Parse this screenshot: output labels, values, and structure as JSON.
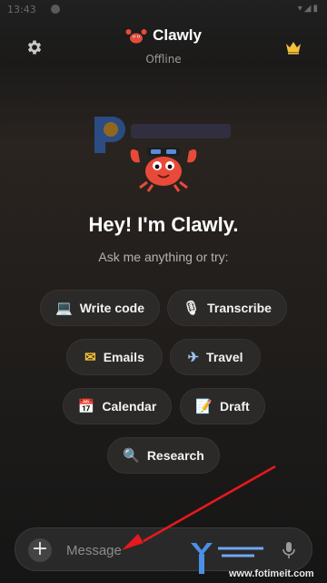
{
  "status_bar": {
    "time": "13:43"
  },
  "header": {
    "app_name": "Clawly",
    "status": "Offline",
    "settings_icon": "gear-icon",
    "premium_icon": "crown-icon",
    "premium_color": "#f3c03a"
  },
  "hero": {
    "title": "Hey! I'm Clawly.",
    "subtitle": "Ask me anything or try:"
  },
  "suggestions": [
    {
      "icon": "💻",
      "label": "Write code"
    },
    {
      "icon": "🎙",
      "label": "Transcribe"
    },
    {
      "icon": "✉",
      "label": "Emails"
    },
    {
      "icon": "✈",
      "label": "Travel"
    },
    {
      "icon": "📅",
      "label": "Calendar"
    },
    {
      "icon": "📝",
      "label": "Draft"
    },
    {
      "icon": "🔍",
      "label": "Research"
    }
  ],
  "composer": {
    "placeholder": "Message",
    "add_icon": "plus-icon",
    "mic_icon": "mic-icon"
  },
  "watermark": {
    "site": "www.fotimeit.com"
  },
  "colors": {
    "accent": "#f3c03a",
    "annotation": "#e5191e"
  }
}
